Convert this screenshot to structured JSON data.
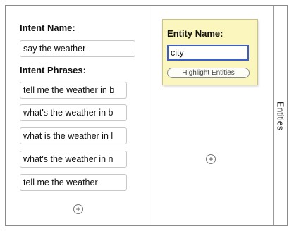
{
  "intent": {
    "name_label": "Intent Name:",
    "name_value": "say the weather",
    "phrases_label": "Intent Phrases:",
    "phrases": [
      "tell me the weather in b",
      "what's the weather in b",
      "what is the weather in l",
      "what's the weather in n",
      "tell me the weather"
    ],
    "add_phrase_icon": "plus-circle-icon"
  },
  "entity": {
    "name_label": "Entity Name:",
    "name_value": "city",
    "highlight_button": "Highlight Entities",
    "add_entity_icon": "plus-circle-icon",
    "card_color": "#fbf6bd",
    "focus_color": "#3a5fcd"
  },
  "side_tab": {
    "label": "Entities"
  }
}
